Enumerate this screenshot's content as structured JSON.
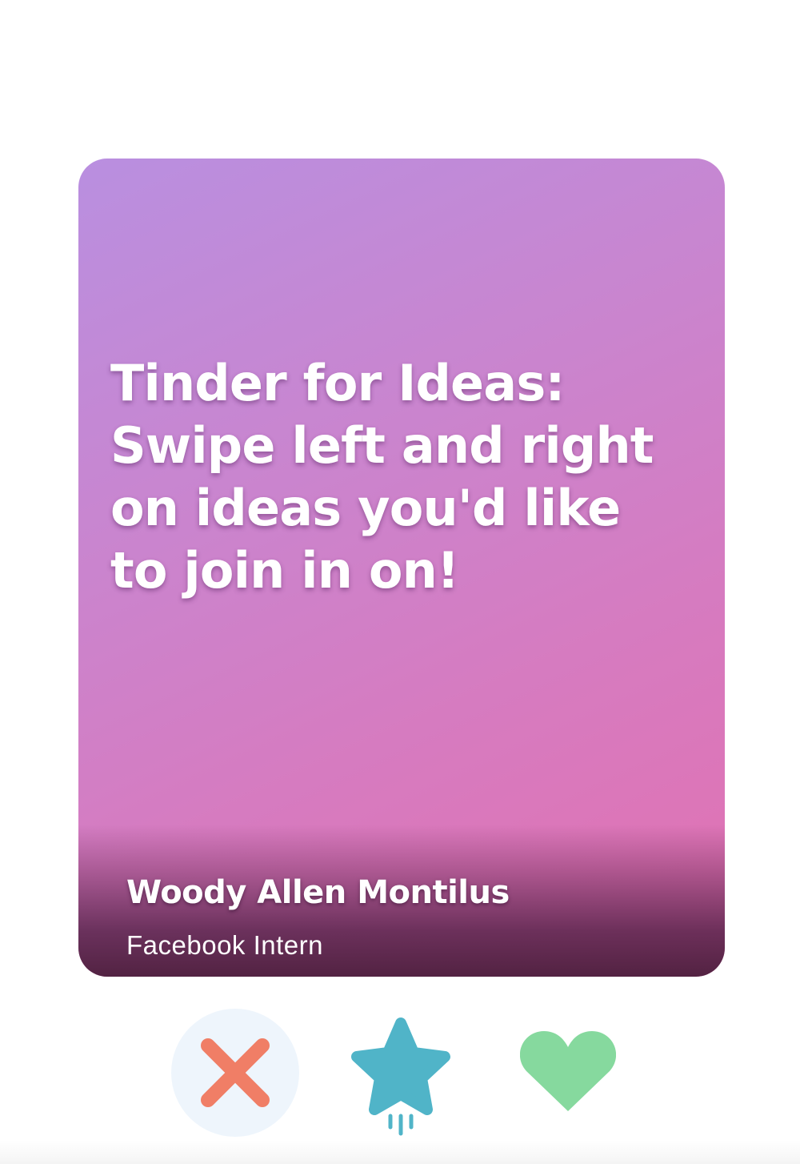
{
  "card": {
    "title": "Tinder for Ideas: Swipe left and right on ideas you'd like to join in on!",
    "author_name": "Woody Allen Montilus",
    "author_role": "Facebook Intern",
    "gradient_colors": [
      "#b98fe0",
      "#c985cf",
      "#d67bc0",
      "#e271b1"
    ]
  },
  "actions": [
    {
      "name": "reject",
      "icon": "close-icon",
      "color": "#f07e66"
    },
    {
      "name": "super-like",
      "icon": "star-icon",
      "color": "#50b4c8"
    },
    {
      "name": "like",
      "icon": "heart-icon",
      "color": "#86d99e"
    }
  ]
}
